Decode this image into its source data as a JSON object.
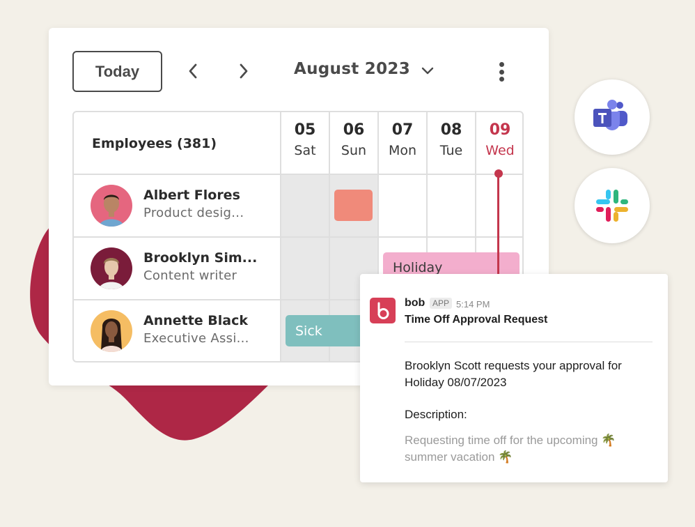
{
  "calendar": {
    "today_label": "Today",
    "prev_label": "previous",
    "next_label": "next",
    "month_label": "August 2023",
    "employees_header": "Employees (381)",
    "days": [
      {
        "num": "05",
        "name": "Sat",
        "weekend": true,
        "today": false
      },
      {
        "num": "06",
        "name": "Sun",
        "weekend": true,
        "today": false
      },
      {
        "num": "07",
        "name": "Mon",
        "weekend": false,
        "today": false
      },
      {
        "num": "08",
        "name": "Tue",
        "weekend": false,
        "today": false
      },
      {
        "num": "09",
        "name": "Wed",
        "weekend": false,
        "today": true
      }
    ],
    "employees": [
      {
        "name": "Albert Flores",
        "role": "Product desig...",
        "avatar_bg": "#e5667f"
      },
      {
        "name": "Brooklyn Sim...",
        "role": "Content writer",
        "avatar_bg": "#7a1c3a"
      },
      {
        "name": "Annette Black",
        "role": "Executive Assi...",
        "avatar_bg": "#f5bd63"
      }
    ],
    "events": [
      {
        "employee": "Albert Flores",
        "label": "",
        "color": "#f08a7a"
      },
      {
        "employee": "Brooklyn Sim...",
        "label": "Holiday",
        "color": "#f3aecd"
      },
      {
        "employee": "Annette Black",
        "label": "Sick",
        "color": "#7fbfbe"
      }
    ],
    "today_color": "#c4364d"
  },
  "integrations": [
    {
      "name": "Microsoft Teams"
    },
    {
      "name": "Slack"
    }
  ],
  "message": {
    "sender": "bob",
    "badge": "APP",
    "time": "5:14 PM",
    "title": "Time Off Approval Request",
    "body": "Brooklyn Scott requests your approval for Holiday 08/07/2023",
    "description_label": "Description:",
    "description": "Requesting time off for the upcoming 🌴 summer vacation 🌴"
  },
  "colors": {
    "background": "#f3f0e8",
    "blob": "#ae2746",
    "brand": "#d73f57"
  }
}
